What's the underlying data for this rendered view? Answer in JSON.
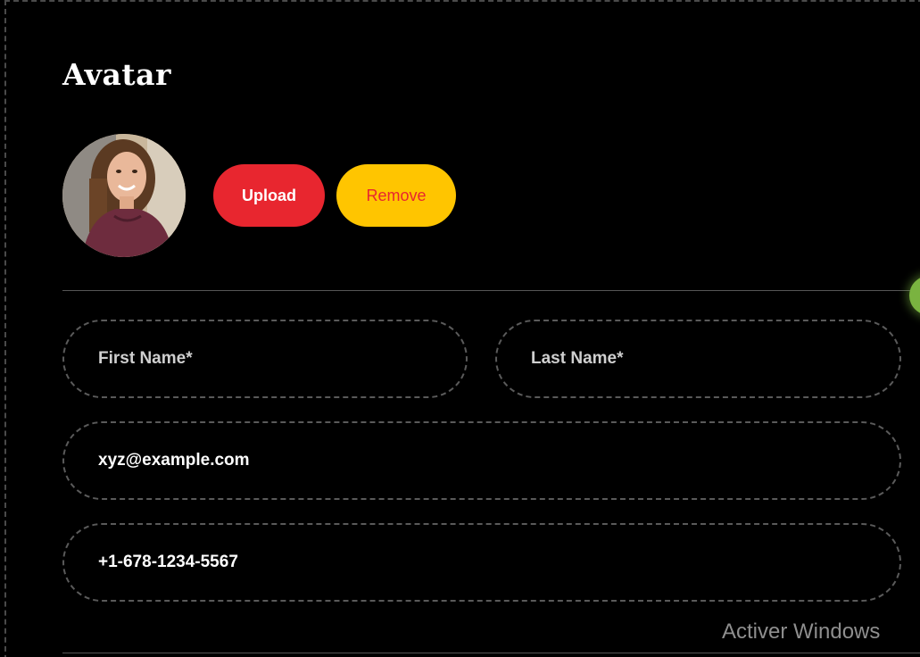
{
  "avatar_section": {
    "title": "Avatar",
    "upload_label": "Upload",
    "remove_label": "Remove",
    "avatar_icon": "user-photo"
  },
  "form": {
    "first_name": {
      "placeholder": "First Name*",
      "value": ""
    },
    "last_name": {
      "placeholder": "Last Name*",
      "value": ""
    },
    "email": {
      "placeholder": "",
      "value": "xyz@example.com"
    },
    "phone": {
      "placeholder": "",
      "value": "+1-678-1234-5567"
    }
  },
  "os_watermark": {
    "line1": "Activer Windows"
  },
  "colors": {
    "background": "#000000",
    "upload_button": "#e8262f",
    "remove_button": "#ffc500",
    "remove_text": "#e8262f",
    "field_border": "#5a5a5a",
    "scroll_indicator": "#7ab340"
  }
}
